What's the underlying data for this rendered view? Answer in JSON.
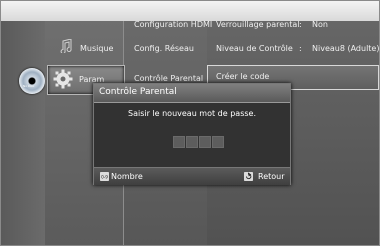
{
  "menu": {
    "music_label": "Musique",
    "settings_label": "Param",
    "disc_label": "No Disc",
    "sub_items": [
      "Configuration HDMI",
      "Config. Réseau",
      "Contrôle Parental"
    ],
    "options": [
      {
        "name": "Verrouillage parental",
        "sep": ":",
        "value": "Non"
      },
      {
        "name": "Niveau de Contrôle",
        "sep": ":",
        "value": "Niveau8 (Adulte)"
      },
      {
        "name": "Créer le code",
        "sep": "",
        "value": ""
      }
    ]
  },
  "dialog": {
    "title": "Contrôle Parental",
    "message": "Saisir le nouveau mot de passe.",
    "footer": {
      "left_icon": "0-9",
      "left_label": "Nombre",
      "right_label": "Retour"
    }
  }
}
